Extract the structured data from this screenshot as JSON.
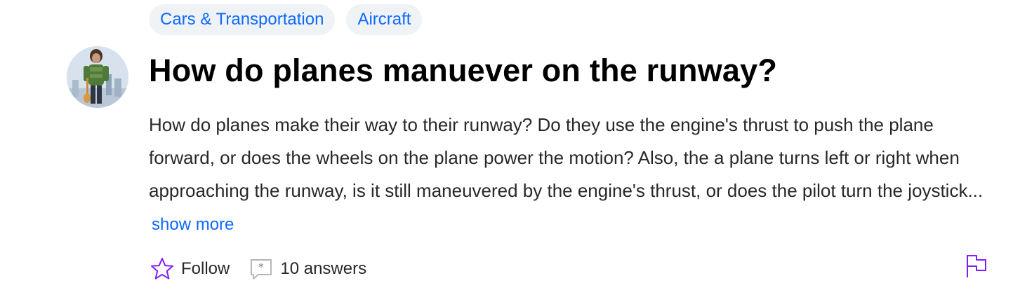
{
  "categories": [
    {
      "label": "Cars & Transportation"
    },
    {
      "label": "Aircraft"
    }
  ],
  "question": {
    "title": "How do planes manuever on the runway?",
    "body": "How do planes make their way to their runway? Do they use the engine's thrust to push the plane forward, or does the wheels on the plane power the motion? Also, the a plane turns left or right when approaching the runway, is it still maneuvered by the engine's thrust, or does the pilot turn the joystick...",
    "show_more_label": "show more"
  },
  "actions": {
    "follow_label": "Follow",
    "answers_label": "10 answers"
  },
  "icons": {
    "follow": "star-icon",
    "answers": "speech-bubble-icon",
    "report": "flag-icon"
  },
  "colors": {
    "link": "#0f69ff",
    "accent": "#7e1fff",
    "pill_bg": "#f0f3f5",
    "title": "#000000",
    "text": "#26282a"
  }
}
